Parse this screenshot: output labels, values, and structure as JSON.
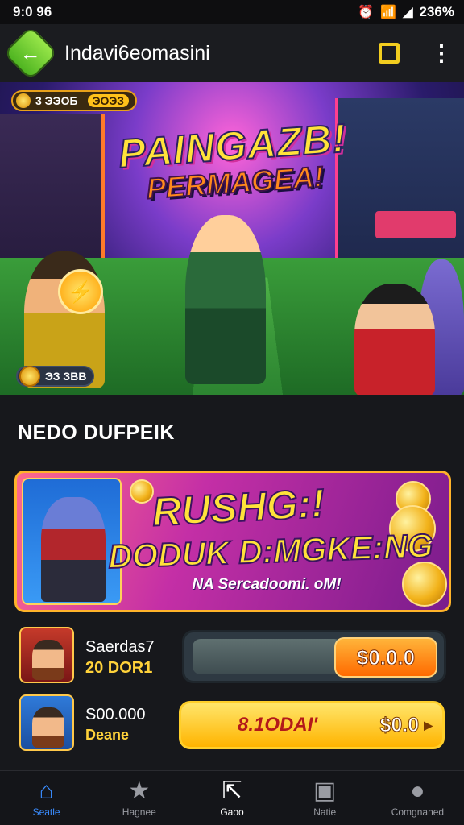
{
  "status_bar": {
    "time": "9:0 96",
    "battery": "236%"
  },
  "app_bar": {
    "title": "Indavi6eomasini"
  },
  "hero": {
    "title_line1": "PAINGAZB!",
    "title_line2": "PERMAGEA!",
    "pill_top_left": "3 ЭЭОБ",
    "pill_top_right": "ЭОЭЗ",
    "pill_bottom": "ЭЗ ЗВВ",
    "orb_icon": "lightning-icon"
  },
  "section": {
    "title": "NEDO DUFPEIK"
  },
  "promo": {
    "headline1": "RUSHG:!",
    "headline2": "DODUK D:MGKE:NG",
    "subtitle": "NA Sercadoomi. oM!"
  },
  "rows": [
    {
      "name": "Saerdas7",
      "meta": "20 DOR1",
      "price": "$0.0.0",
      "progress": 0.62
    },
    {
      "name": "S00.000",
      "meta": "Deane",
      "cta_label": "8.1ODAI'",
      "price": "$0.0"
    }
  ],
  "nav": [
    {
      "label": "Seatle",
      "icon": "home-icon"
    },
    {
      "label": "Hagnee",
      "icon": "star-icon"
    },
    {
      "label": "Gaoo",
      "icon": "share-icon"
    },
    {
      "label": "Natie",
      "icon": "image-icon"
    },
    {
      "label": "Comgnaned",
      "icon": "profile-icon"
    }
  ],
  "colors": {
    "accent": "#3a8cff",
    "cta": "#ffb400",
    "price": "#ff6a00",
    "back": "#6ccb2c",
    "frame": "#ffb32a"
  }
}
